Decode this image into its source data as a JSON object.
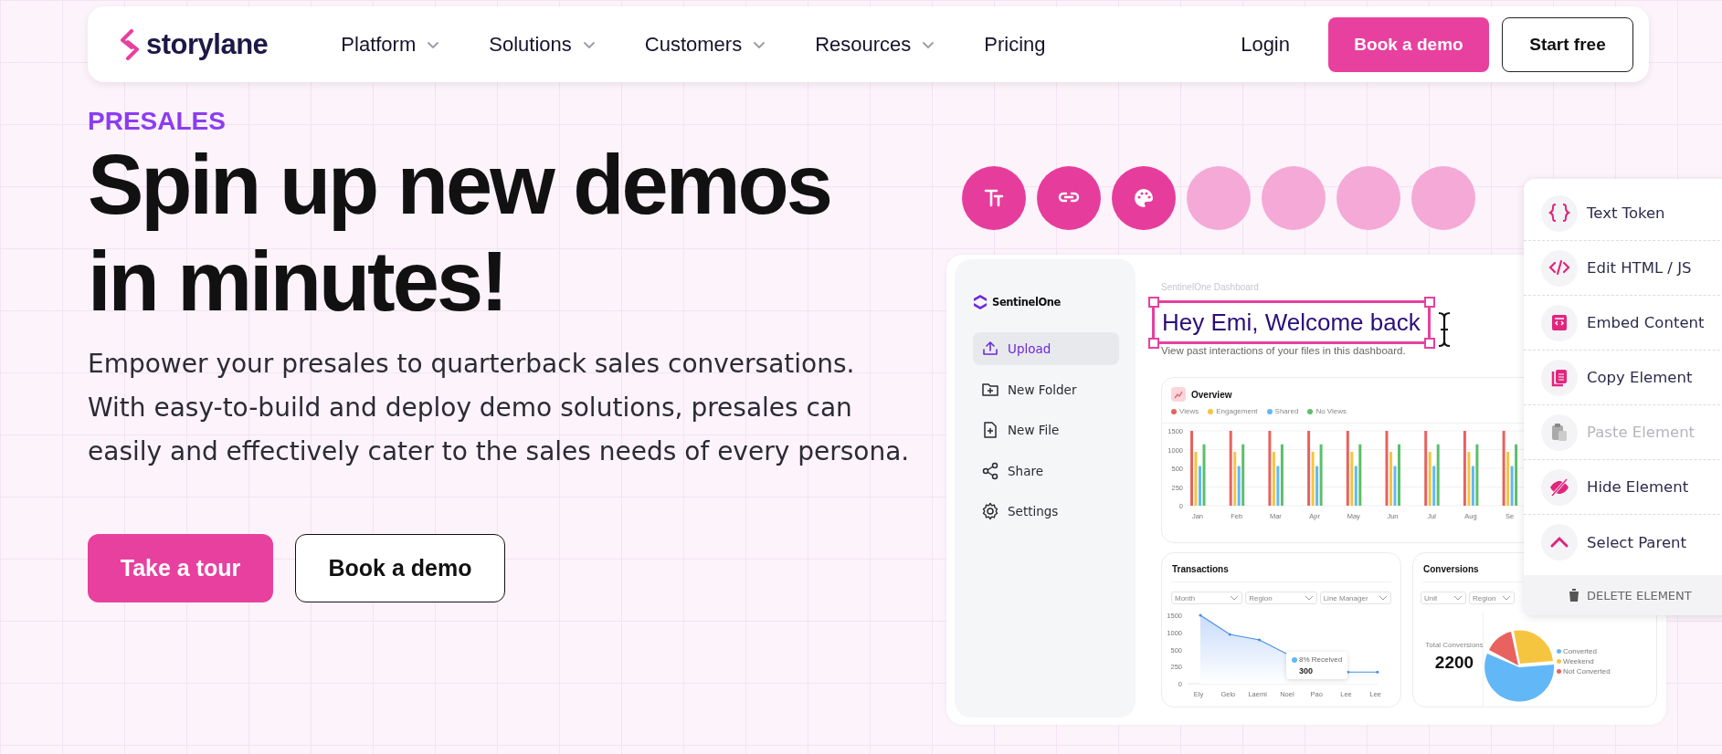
{
  "nav": {
    "logo": "storylane",
    "items": [
      {
        "label": "Platform",
        "has_menu": true
      },
      {
        "label": "Solutions",
        "has_menu": true
      },
      {
        "label": "Customers",
        "has_menu": true
      },
      {
        "label": "Resources",
        "has_menu": true
      },
      {
        "label": "Pricing",
        "has_menu": false
      }
    ],
    "login": "Login",
    "primary_button": "Book a demo",
    "secondary_button": "Start free"
  },
  "hero": {
    "eyebrow": "PRESALES",
    "headline": "Spin up new demos in minutes!",
    "description": "Empower your presales to quarterback sales conversations. With easy-to-build and deploy demo solutions, presales can easily and effectively cater to the sales needs of every persona.",
    "buttons": [
      {
        "label": "Take a tour",
        "kind": "primary"
      },
      {
        "label": "Book a demo",
        "kind": "secondary"
      }
    ]
  },
  "toolbar": [
    {
      "kind": "text-size",
      "active": true
    },
    {
      "kind": "link",
      "active": true
    },
    {
      "kind": "palette",
      "active": true
    },
    {
      "kind": "blank",
      "active": false
    },
    {
      "kind": "blank",
      "active": false
    },
    {
      "kind": "blank",
      "active": false
    },
    {
      "kind": "blank",
      "active": false
    }
  ],
  "demo": {
    "sidebar": {
      "brand": "SentinelOne",
      "items": [
        {
          "label": "Upload",
          "kind": "upload",
          "selected": true
        },
        {
          "label": "New Folder",
          "kind": "folder",
          "selected": false
        },
        {
          "label": "New File",
          "kind": "file",
          "selected": false
        },
        {
          "label": "Share",
          "kind": "share",
          "selected": false
        },
        {
          "label": "Settings",
          "kind": "gear",
          "selected": false
        }
      ]
    },
    "breadcrumb": "SentinelOne Dashboard",
    "title": "Hey Emi, Welcome back",
    "title_selected": true,
    "subtitle": "View past interactions of your files in this dashboard.",
    "overview": {
      "title": "Overview",
      "legend": [
        {
          "label": "Views",
          "color": "#e8625f"
        },
        {
          "label": "Engagement",
          "color": "#f5c540"
        },
        {
          "label": "Shared",
          "color": "#62b8f6"
        },
        {
          "label": "No Views",
          "color": "#5cbf6a"
        }
      ],
      "y_axis_labels": [
        "1500",
        "1000",
        "500",
        "250",
        "0"
      ],
      "x_axis_labels": [
        "Jan",
        "Feb",
        "Mar",
        "Apr",
        "May",
        "Jun",
        "Jul",
        "Aug",
        "Se"
      ]
    },
    "transactions": {
      "title": "Transactions",
      "filters": [
        "Month",
        "Region",
        "Line Manager"
      ],
      "y_axis_labels": [
        "1500",
        "1000",
        "500",
        "250",
        "0"
      ],
      "x_axis_labels": [
        "Ely",
        "Gelo",
        "Laemi",
        "Noel",
        "Pao",
        "Lee",
        "Lee"
      ],
      "tooltip": {
        "label": "8% Received",
        "value": "300"
      }
    },
    "conversions": {
      "title": "Conversions",
      "filters": [
        "Unit",
        "Region"
      ],
      "total_label": "Total Conversions",
      "total": "2200",
      "legend": [
        {
          "label": "Converted",
          "color": "#62b8f6"
        },
        {
          "label": "Weekend",
          "color": "#f5c540"
        },
        {
          "label": "Not Converted",
          "color": "#e8625f"
        }
      ]
    }
  },
  "context_menu": {
    "items": [
      {
        "label": "Text Token",
        "kind": "braces",
        "disabled": false
      },
      {
        "label": "Edit HTML / JS",
        "kind": "code",
        "disabled": false
      },
      {
        "label": "Embed Content",
        "kind": "embed",
        "disabled": false
      },
      {
        "label": "Copy Element",
        "kind": "copy",
        "disabled": false
      },
      {
        "label": "Paste Element",
        "kind": "paste",
        "disabled": true
      },
      {
        "label": "Hide Element",
        "kind": "hide",
        "disabled": false
      },
      {
        "label": "Select Parent",
        "kind": "parent",
        "disabled": false
      }
    ],
    "footer": "DELETE ELEMENT"
  }
}
